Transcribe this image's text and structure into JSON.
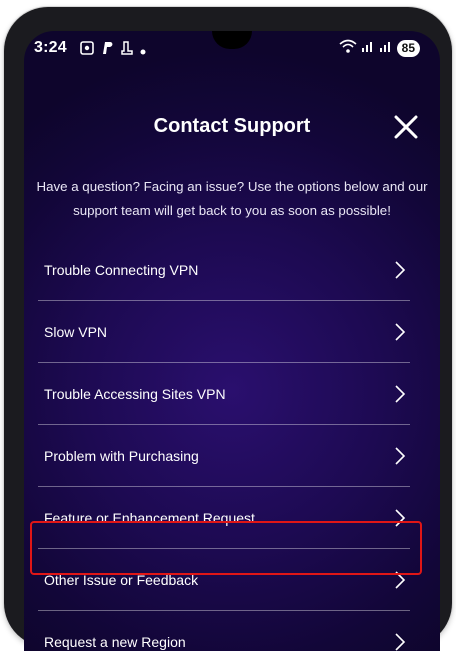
{
  "status_bar": {
    "time": "3:24",
    "battery": "85"
  },
  "header": {
    "title": "Contact Support",
    "close_icon": "close-icon"
  },
  "intro_text": "Have a question? Facing an issue? Use the options below and our support team will get back to you as soon as possible!",
  "options": [
    {
      "label": "Trouble Connecting VPN"
    },
    {
      "label": "Slow VPN"
    },
    {
      "label": "Trouble Accessing Sites VPN"
    },
    {
      "label": "Problem with Purchasing"
    },
    {
      "label": "Feature or Enhancement Request"
    },
    {
      "label": "Other Issue or Feedback",
      "highlighted": true
    },
    {
      "label": "Request a new Region"
    }
  ],
  "colors": {
    "background": "#1d0a52",
    "text": "#ffffff",
    "highlight": "#e01616"
  }
}
